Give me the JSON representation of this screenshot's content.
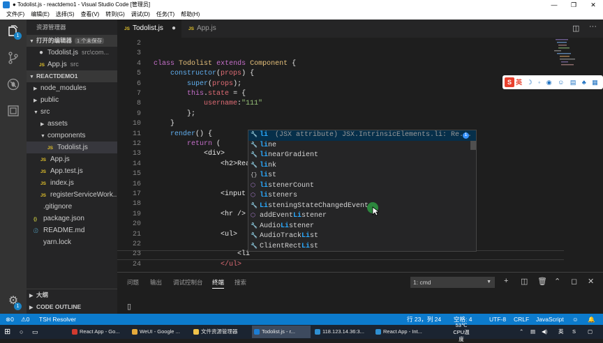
{
  "window": {
    "title": "● Todolist.js - reactdemo1 - Visual Studio Code [管理员]"
  },
  "menu": [
    "文件(F)",
    "编辑(E)",
    "选择(S)",
    "查看(V)",
    "转到(G)",
    "调试(D)",
    "任务(T)",
    "帮助(H)"
  ],
  "activity": {
    "badge_explorer": "1",
    "badge_settings": "1"
  },
  "sidebar": {
    "title": "资源管理器",
    "open_editors": {
      "label": "打开的编辑器",
      "count": "1 个未保存"
    },
    "open_files": [
      {
        "dot": "●",
        "name": "Todolist.js",
        "path": "src\\com..."
      },
      {
        "badge": "JS",
        "name": "App.js",
        "path": "src"
      }
    ],
    "project": "REACTDEMO1",
    "tree": [
      {
        "indent": 1,
        "arrow": "▶",
        "name": "node_modules"
      },
      {
        "indent": 1,
        "arrow": "▶",
        "name": "public"
      },
      {
        "indent": 1,
        "arrow": "▼",
        "name": "src"
      },
      {
        "indent": 2,
        "arrow": "▶",
        "name": "assets"
      },
      {
        "indent": 2,
        "arrow": "▼",
        "name": "components"
      },
      {
        "indent": 3,
        "badge": "JS",
        "name": "Todolist.js",
        "selected": true
      },
      {
        "indent": 2,
        "badge": "JS",
        "name": "App.js"
      },
      {
        "indent": 2,
        "badge": "JS",
        "name": "App.test.js"
      },
      {
        "indent": 2,
        "badge": "JS",
        "name": "index.js"
      },
      {
        "indent": 2,
        "badge": "JS",
        "name": "registerServiceWork..."
      },
      {
        "indent": 1,
        "badge": "",
        "name": ".gitignore"
      },
      {
        "indent": 1,
        "badge": "{}",
        "name": "package.json"
      },
      {
        "indent": 1,
        "badge": "ⓘ",
        "name": "README.md"
      },
      {
        "indent": 1,
        "badge": "",
        "name": "yarn.lock"
      }
    ],
    "outline": "大纲",
    "code_outline": "CODE OUTLINE"
  },
  "tabs": [
    {
      "badge": "JS",
      "name": "Todolist.js",
      "active": true,
      "close": "●"
    },
    {
      "badge": "JS",
      "name": "App.js",
      "active": false
    }
  ],
  "code_lines": [
    {
      "n": "2",
      "html": ""
    },
    {
      "n": "3",
      "html": ""
    },
    {
      "n": "4",
      "html": "<span class='k'>class</span> <span class='cl'>Todolist</span> <span class='k'>extends</span> <span class='cl'>Component</span> {"
    },
    {
      "n": "5",
      "html": "    <span class='fn'>constructor</span>(<span class='p'>props</span>) {"
    },
    {
      "n": "6",
      "html": "        <span class='fn'>super</span>(<span class='p'>props</span>);"
    },
    {
      "n": "7",
      "html": "        <span class='th'>this</span>.<span class='t'>state</span> = {"
    },
    {
      "n": "8",
      "html": "            <span class='t'>username</span>:<span class='s'>\"111\"</span>"
    },
    {
      "n": "9",
      "html": "        };"
    },
    {
      "n": "10",
      "html": "    }"
    },
    {
      "n": "11",
      "html": "    <span class='fn'>render</span>() {"
    },
    {
      "n": "12",
      "html": "        <span class='k'>return</span> ("
    },
    {
      "n": "13",
      "html": "            <span class='pl'>&lt;div&gt;</span>"
    },
    {
      "n": "14",
      "html": "                &lt;h2&gt;Rea"
    },
    {
      "n": "15",
      "html": ""
    },
    {
      "n": "16",
      "html": ""
    },
    {
      "n": "17",
      "html": "                &lt;input"
    },
    {
      "n": "18",
      "html": ""
    },
    {
      "n": "19",
      "html": "                &lt;hr /&gt;"
    },
    {
      "n": "20",
      "html": ""
    },
    {
      "n": "21",
      "html": "                &lt;ul&gt;"
    },
    {
      "n": "22",
      "html": ""
    },
    {
      "n": "23",
      "html": "                    &lt;li"
    },
    {
      "n": "24",
      "html": "                <span class='t'>&lt;/ul&gt;</span>"
    }
  ],
  "suggestions": [
    {
      "icon": "wrench",
      "pre": "li",
      "post": "",
      "detail": "(JSX attribute) JSX.IntrinsicElements.li: Re...",
      "selected": true
    },
    {
      "icon": "wrench",
      "pre": "li",
      "post": "ne"
    },
    {
      "icon": "wrench",
      "pre": "li",
      "post": "nearGradient"
    },
    {
      "icon": "wrench",
      "pre": "li",
      "post": "nk"
    },
    {
      "icon": "braces",
      "pre": "li",
      "post": "st"
    },
    {
      "icon": "cube",
      "pre": "li",
      "post": "stenerCount"
    },
    {
      "icon": "cube",
      "pre": "li",
      "post": "steners"
    },
    {
      "icon": "wrench",
      "pre": "Li",
      "post": "steningStateChangedEvent",
      "lead": ""
    },
    {
      "icon": "cube",
      "lead": "addEvent",
      "pre": "Li",
      "post": "stener"
    },
    {
      "icon": "wrench",
      "lead": "Audio",
      "pre": "Li",
      "post": "stener"
    },
    {
      "icon": "wrench",
      "lead": "AudioTrack",
      "pre": "Li",
      "post": "st"
    },
    {
      "icon": "wrench",
      "lead": "ClientRect",
      "pre": "Li",
      "post": "st"
    }
  ],
  "ime": {
    "lang": "英"
  },
  "panel": {
    "tabs": [
      "问题",
      "输出",
      "调试控制台",
      "终端",
      "搜索"
    ],
    "active": "终端",
    "terminal": "1: cmd",
    "prompt": "▯"
  },
  "status": {
    "errors": "0",
    "warnings": "0",
    "resolver": "TSH Resolver",
    "position": "行 23，列 24",
    "spaces": "空格: 4",
    "encoding": "UTF-8",
    "eol": "CRLF",
    "language": "JavaScript"
  },
  "taskbar": {
    "items": [
      "React App - Go...",
      "WeUI - Google ...",
      "文件资源管理器",
      "Todolist.js - r...",
      "118.123.14.36:3...",
      "React App - Int..."
    ],
    "temp": "53℃",
    "temp_label": "CPU温度",
    "ime": "英"
  }
}
